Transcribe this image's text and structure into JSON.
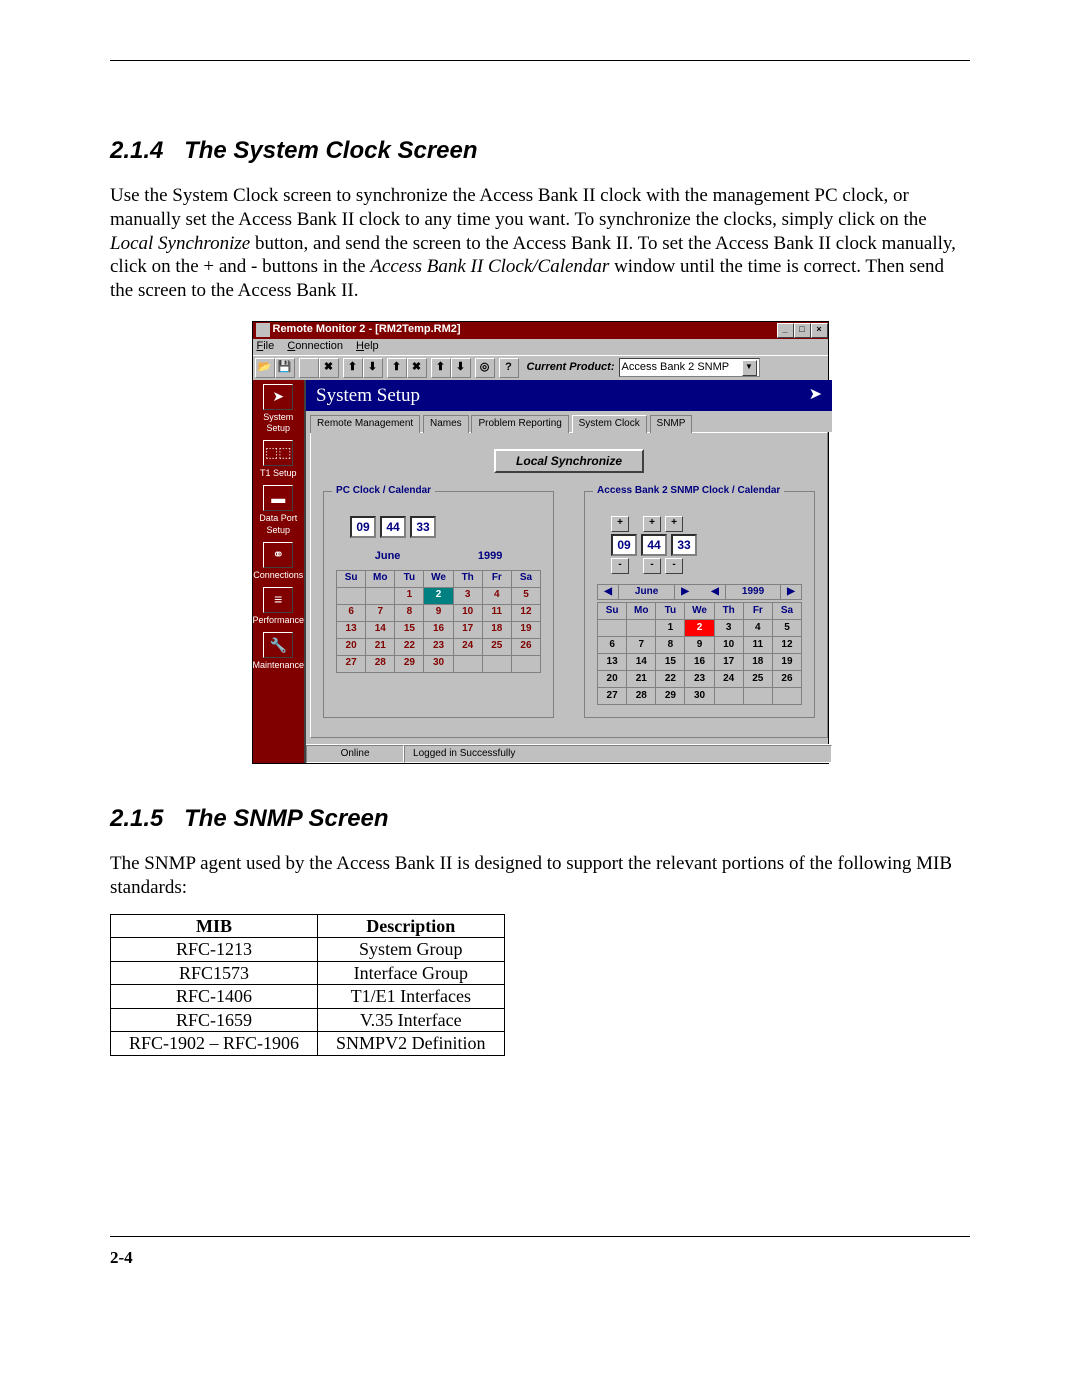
{
  "section1": {
    "number": "2.1.4",
    "title": "The System Clock Screen",
    "paragraph_pre": "Use the System Clock screen to synchronize the Access Bank II clock with the management PC clock, or manually set the Access Bank II clock to any time you want. To synchronize the clocks, simply click on the ",
    "em1": "Local Synchronize",
    "paragraph_mid": " button, and send the screen to the Access Bank II. To set the Access Bank II clock manually, click on the + and - buttons in the ",
    "em2": "Access Bank II Clock/Calendar",
    "paragraph_post": " window until the time is correct. Then send the screen to the Access Bank II."
  },
  "screenshot": {
    "window_title": "Remote Monitor 2 - [RM2Temp.RM2]",
    "menus": {
      "file": "File",
      "connection": "Connection",
      "help": "Help"
    },
    "toolbar": {
      "current_product_label": "Current Product:",
      "current_product_value": "Access Bank 2 SNMP",
      "help_btn": "?"
    },
    "sidebar": [
      "System Setup",
      "T1 Setup",
      "Data Port Setup",
      "Connections",
      "Performance",
      "Maintenance"
    ],
    "main_header": "System Setup",
    "tabs": [
      "Remote Management",
      "Names",
      "Problem Reporting",
      "System Clock",
      "SNMP"
    ],
    "active_tab": "System Clock",
    "sync_button": "Local Synchronize",
    "pc_clock": {
      "legend": "PC Clock / Calendar",
      "hh": "09",
      "mm": "44",
      "ss": "33",
      "month": "June",
      "year": "1999",
      "days": [
        "Su",
        "Mo",
        "Tu",
        "We",
        "Th",
        "Fr",
        "Sa"
      ],
      "weeks": [
        [
          "",
          "",
          "1",
          "2",
          "3",
          "4",
          "5"
        ],
        [
          "6",
          "7",
          "8",
          "9",
          "10",
          "11",
          "12"
        ],
        [
          "13",
          "14",
          "15",
          "16",
          "17",
          "18",
          "19"
        ],
        [
          "20",
          "21",
          "22",
          "23",
          "24",
          "25",
          "26"
        ],
        [
          "27",
          "28",
          "29",
          "30",
          "",
          "",
          ""
        ]
      ],
      "today": "2"
    },
    "ab_clock": {
      "legend": "Access Bank 2 SNMP Clock / Calendar",
      "hh": "09",
      "mm": "44",
      "ss": "33",
      "month": "June",
      "year": "1999",
      "days": [
        "Su",
        "Mo",
        "Tu",
        "We",
        "Th",
        "Fr",
        "Sa"
      ],
      "weeks": [
        [
          "",
          "",
          "1",
          "2",
          "3",
          "4",
          "5"
        ],
        [
          "6",
          "7",
          "8",
          "9",
          "10",
          "11",
          "12"
        ],
        [
          "13",
          "14",
          "15",
          "16",
          "17",
          "18",
          "19"
        ],
        [
          "20",
          "21",
          "22",
          "23",
          "24",
          "25",
          "26"
        ],
        [
          "27",
          "28",
          "29",
          "30",
          "",
          "",
          ""
        ]
      ],
      "today": "2"
    },
    "status": {
      "left": "Online",
      "right": "Logged in Successfully"
    }
  },
  "section2": {
    "number": "2.1.5",
    "title": "The SNMP Screen",
    "paragraph": "The SNMP agent used by the Access Bank II is designed to support the relevant portions of the following MIB standards:"
  },
  "mib_table": {
    "headers": [
      "MIB",
      "Description"
    ],
    "rows": [
      [
        "RFC-1213",
        "System Group"
      ],
      [
        "RFC1573",
        "Interface Group"
      ],
      [
        "RFC-1406",
        "T1/E1 Interfaces"
      ],
      [
        "RFC-1659",
        "V.35 Interface"
      ],
      [
        "RFC-1902 – RFC-1906",
        "SNMPV2 Definition"
      ]
    ]
  },
  "page_number": "2-4"
}
